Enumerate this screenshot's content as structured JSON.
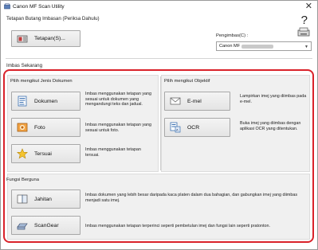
{
  "window": {
    "title": "Canon MF Scan Utility",
    "close_glyph": "✕"
  },
  "top": {
    "heading": "Tetapan Butang Imbasan (Periksa Dahulu)",
    "settings_button": "Tetapan(S)...",
    "help_glyph": "?",
    "scanner_label": "Pengimbas(C) :",
    "scanner_value": "Canon MF"
  },
  "scan_now": {
    "heading": "Imbas Sekarang"
  },
  "doc_types": {
    "heading": "Pilih mengikut Jenis Dokumen",
    "items": [
      {
        "label": "Dokumen",
        "desc": "Imbas menggunakan tetapan yang sesuai untuk dokumen yang mengandungi teks dan jadual.",
        "icon": "document-icon"
      },
      {
        "label": "Foto",
        "desc": "Imbas menggunakan tetapan yang sesuai untuk foto.",
        "icon": "photo-icon"
      },
      {
        "label": "Tersuai",
        "desc": "Imbas menggunakan tetapan tersuai.",
        "icon": "star-icon"
      }
    ]
  },
  "objectives": {
    "heading": "Pilih mengikut Objektif",
    "items": [
      {
        "label": "E-mel",
        "desc": "Lampirkan imej yang diimbas pada e-mel.",
        "icon": "email-icon"
      },
      {
        "label": "OCR",
        "desc": "Buka imej yang diimbas dengan aplikasi OCR yang ditentukan.",
        "icon": "ocr-icon"
      }
    ]
  },
  "useful": {
    "heading": "Fungsi Berguna",
    "items": [
      {
        "label": "Jahitan",
        "desc": "Imbas dokumen yang lebih besar daripada kaca platen dalam dua bahagian, dan gabungkan imej yang diimbas menjadi satu imej.",
        "icon": "stitch-icon"
      },
      {
        "label": "ScanGear",
        "desc": "Imbas menggunakan tetapan terperinci seperti pembetulan imej dan fungsi lain seperti pratonton.",
        "icon": "scanner-icon"
      }
    ]
  },
  "colors": {
    "highlight": "#d9222a",
    "panel": "#f0f0f0"
  }
}
